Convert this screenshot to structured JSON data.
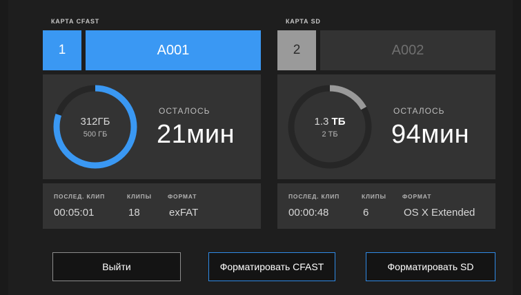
{
  "cards": [
    {
      "title": "КАРТА CFAST",
      "slot": "1",
      "clip_name": "A001",
      "active": true,
      "used": "312ГБ",
      "used_unit": "",
      "total": "500 ГБ",
      "fill_fraction": 0.8,
      "remaining_label": "ОСТАЛОСЬ",
      "remaining_value": "21мин",
      "info_labels": [
        "ПОСЛЕД. КЛИП",
        "КЛИПЫ",
        "ФОРМАТ"
      ],
      "last_clip": "00:05:01",
      "clips": "18",
      "format": "exFAT"
    },
    {
      "title": "КАРТА SD",
      "slot": "2",
      "clip_name": "A002",
      "active": false,
      "used": "1.3",
      "used_unit": "ТБ",
      "total": "2 ТБ",
      "fill_fraction": 0.17,
      "remaining_label": "ОСТАЛОСЬ",
      "remaining_value": "94мин",
      "info_labels": [
        "ПОСЛЕД. КЛИП",
        "КЛИПЫ",
        "ФОРМАТ"
      ],
      "last_clip": "00:00:48",
      "clips": "6",
      "format": "OS X Extended"
    }
  ],
  "buttons": {
    "exit": "Выйти",
    "format_cfast": "Форматировать CFAST",
    "format_sd": "Форматировать SD"
  },
  "colors": {
    "accent": "#3a98f3",
    "ring_track": "#262626",
    "sd_fill": "#9a9a9a"
  }
}
